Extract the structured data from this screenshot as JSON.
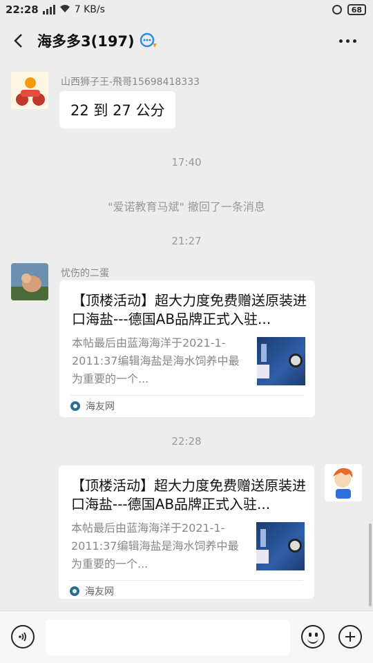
{
  "status_bar": {
    "time": "22:28",
    "network_type": "3G",
    "speed": "7 KB/s",
    "battery": "68"
  },
  "header": {
    "title": "海多多3(197)",
    "back_icon": "back-arrow-icon",
    "more_icon": "more-dots-icon"
  },
  "messages": {
    "m1": {
      "sender": "山西狮子王-飛哥15698418333",
      "text": "22 到 27 公分"
    },
    "time1": "17:40",
    "recall": "\"爱诺教育马斌\" 撤回了一条消息",
    "time2": "21:27",
    "m2": {
      "sender": "忧伤的二蛋",
      "card_title": "【顶楼活动】超大力度免费赠送原装进口海盐---德国AB品牌正式入驻...",
      "card_desc": "本帖最后由蓝海海洋于2021-1-2011:37编辑海盐是海水饲养中最为重要的一个...",
      "source": "海友网"
    },
    "time3": "22:28",
    "m3": {
      "card_title": "【顶楼活动】超大力度免费赠送原装进口海盐---德国AB品牌正式入驻...",
      "card_desc": "本帖最后由蓝海海洋于2021-1-2011:37编辑海盐是海水饲养中最为重要的一个...",
      "source": "海友网"
    }
  },
  "input_bar": {
    "placeholder": "",
    "voice_icon": "voice-icon",
    "emoji_icon": "emoji-icon",
    "plus_icon": "plus-icon"
  },
  "colors": {
    "background": "#ededed",
    "bubble": "#ffffff",
    "meta_text": "#999999"
  }
}
